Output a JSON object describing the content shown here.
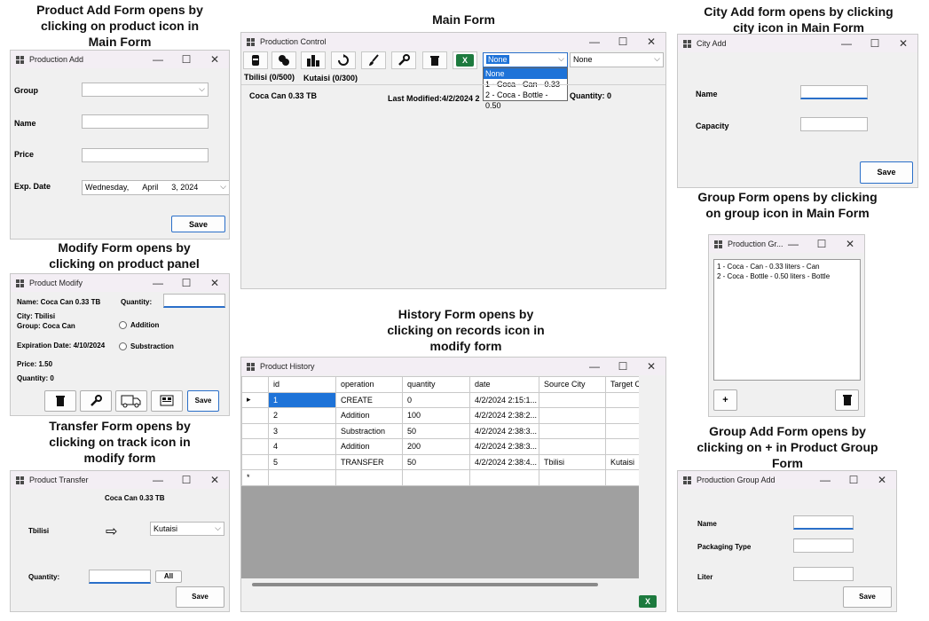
{
  "captions": {
    "product_add": "Product Add Form opens by clicking on product  icon in Main Form",
    "main": "Main Form",
    "city_add": "City Add form opens by clicking city icon in Main Form",
    "group": "Group  Form opens by clicking on group icon  in Main Form",
    "modify": "Modify Form opens by clicking on product panel",
    "history": "History Form opens by clicking on records icon in modify form",
    "transfer": "Transfer Form opens by clicking on track icon in modify form",
    "group_add": "Group Add Form opens by clicking on + in Product Group Form"
  },
  "window_controls": {
    "minimize": "—",
    "maximize": "☐",
    "close": "✕"
  },
  "product_add": {
    "title": "Production Add",
    "group_label": "Group",
    "group_value": "",
    "name_label": "Name",
    "name_value": "",
    "price_label": "Price",
    "price_value": "",
    "exp_label": "Exp. Date",
    "exp_weekday": "Wednesday,",
    "exp_month": "April",
    "exp_day_year": "3, 2024",
    "save": "Save"
  },
  "main": {
    "title": "Production Control",
    "toolbar_icons": [
      "product-icon",
      "group-icon",
      "city-icon",
      "refresh-icon",
      "brush-icon",
      "wrench-icon",
      "trash-icon",
      "excel-icon"
    ],
    "excel_label": "X",
    "dropdown1_value": "None",
    "dropdown2_value": "None",
    "dropdown_options": [
      "None",
      "1 - Coca - Can - 0.33",
      "2 - Coca - Bottle - 0.50"
    ],
    "tabs": [
      "Tbilisi (0/500)",
      "Kutaisi (0/300)"
    ],
    "product_name": "Coca Can 0.33 TB",
    "last_modified": "Last Modified:4/2/2024 2",
    "quantity": "Quantity: 0"
  },
  "city_add": {
    "title": "City Add",
    "name_label": "Name",
    "capacity_label": "Capacity",
    "name_value": "",
    "capacity_value": "",
    "save": "Save"
  },
  "group_form": {
    "title": "Production Gr...",
    "items": [
      "1 - Coca - Can - 0.33 liters - Can",
      "2 - Coca - Bottle - 0.50 liters - Bottle"
    ],
    "add": "+"
  },
  "modify": {
    "title": "Product Modify",
    "name": "Name: Coca Can 0.33 TB",
    "quantity_label": "Quantity:",
    "quantity_value": "",
    "city": "City: Tbilisi",
    "group": "Group: Coca Can",
    "addition": "Addition",
    "subtraction": "Substraction",
    "expiration": "Expiration Date: 4/10/2024",
    "price": "Price: 1.50",
    "quantity": "Quantity: 0",
    "save": "Save"
  },
  "history": {
    "title": "Product History",
    "columns": [
      "id",
      "operation",
      "quantity",
      "date",
      "Source City",
      "Target Ci"
    ],
    "rows": [
      [
        "1",
        "CREATE",
        "0",
        "4/2/2024 2:15:1...",
        "",
        ""
      ],
      [
        "2",
        "Addition",
        "100",
        "4/2/2024 2:38:2...",
        "",
        ""
      ],
      [
        "3",
        "Substraction",
        "50",
        "4/2/2024 2:38:3...",
        "",
        ""
      ],
      [
        "4",
        "Addition",
        "200",
        "4/2/2024 2:38:3...",
        "",
        ""
      ],
      [
        "5",
        "TRANSFER",
        "50",
        "4/2/2024 2:38:4...",
        "Tbilisi",
        "Kutaisi"
      ]
    ],
    "current_marker": "▸",
    "new_marker": "*",
    "excel_label": "X"
  },
  "transfer": {
    "title": "Product Transfer",
    "product": "Coca Can 0.33 TB",
    "source": "Tbilisi",
    "arrow": "⇨",
    "target": "Kutaisi",
    "quantity_label": "Quantity:",
    "quantity_value": "",
    "all": "All",
    "save": "Save"
  },
  "group_add": {
    "title": "Production Group Add",
    "name_label": "Name",
    "packaging_label": "Packaging Type",
    "liter_label": "Liter",
    "name_value": "",
    "packaging_value": "",
    "liter_value": "",
    "save": "Save"
  }
}
